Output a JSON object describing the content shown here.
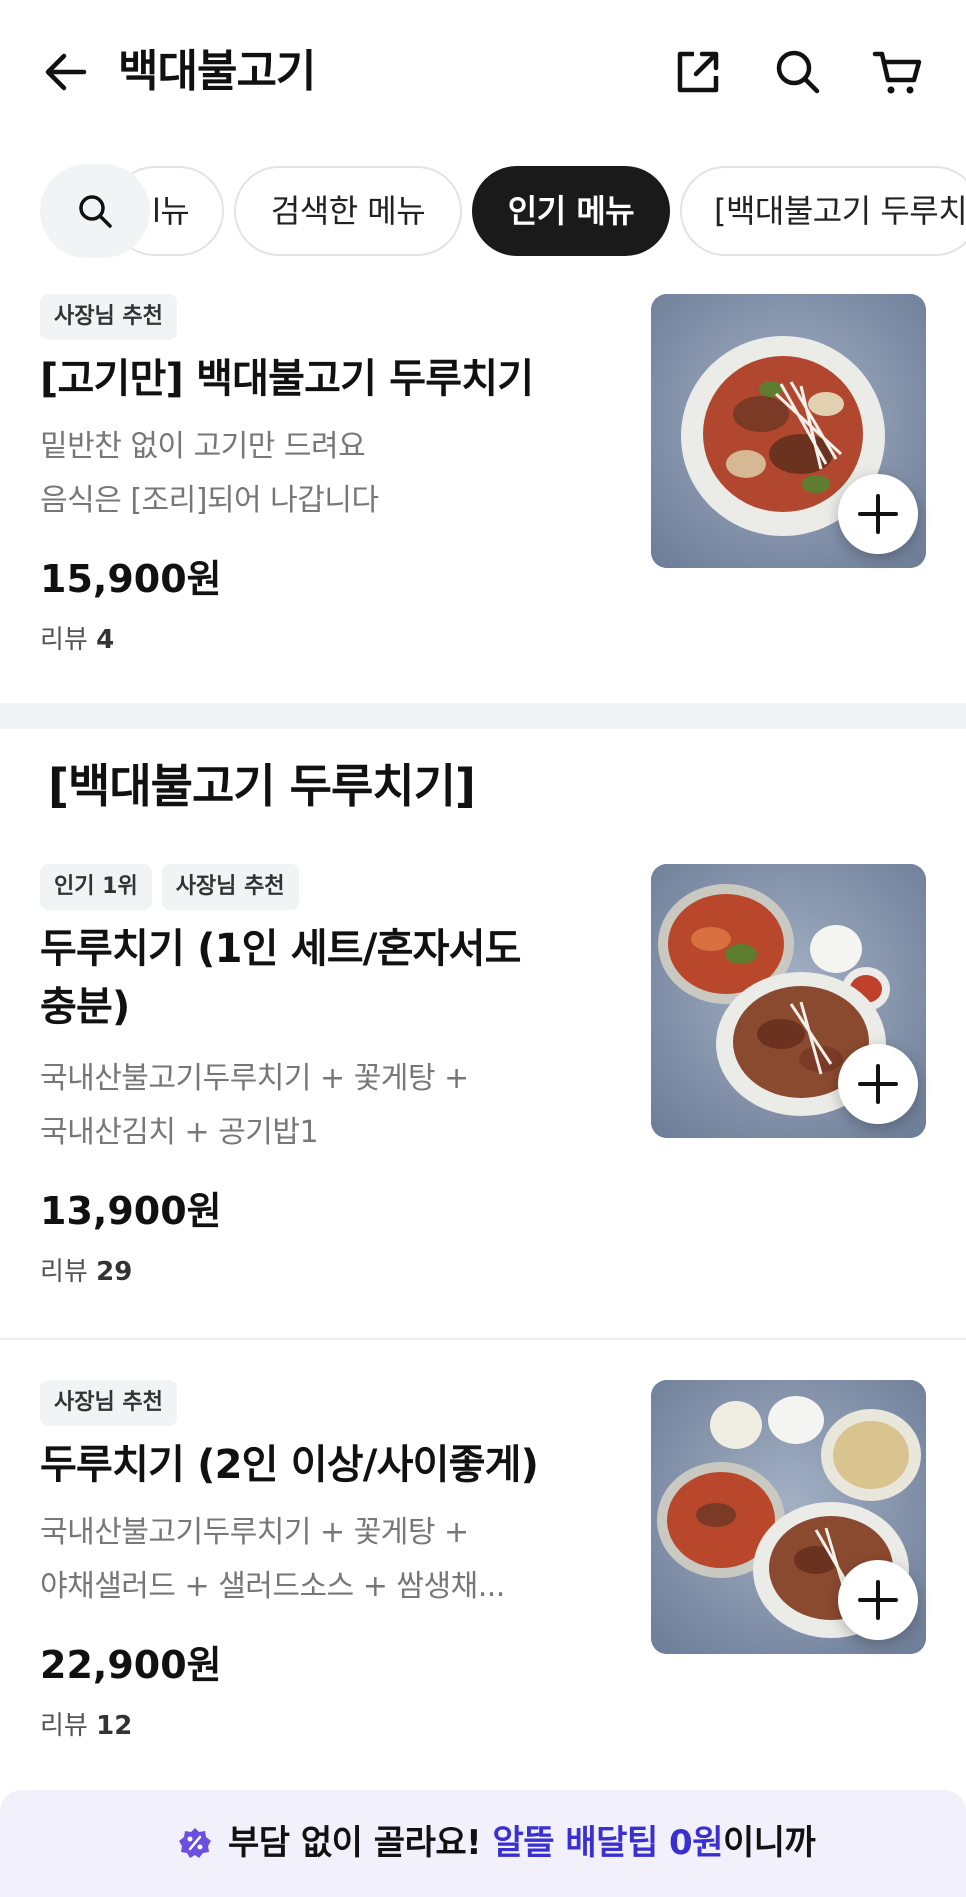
{
  "header": {
    "title": "백대불고기",
    "icons": [
      "back-arrow-icon",
      "share-icon",
      "search-icon",
      "cart-icon"
    ]
  },
  "tabs": {
    "items": [
      {
        "label": "메뉴",
        "partial_visible": "l뉴",
        "active": false
      },
      {
        "label": "검색한 메뉴",
        "active": false
      },
      {
        "label": "인기 메뉴",
        "active": true
      },
      {
        "label": "[백대불고기 두루치",
        "active": false
      }
    ]
  },
  "items": [
    {
      "badges": [
        "사장님 추천"
      ],
      "name": "[고기만] 백대불고기 두루치기",
      "desc1": "밑반찬 없이 고기만 드려요",
      "desc2": "음식은 [조리]되어 나갑니다",
      "price": "15,900원",
      "review_label": "리뷰",
      "review_count": "4"
    },
    {
      "badges": [
        "인기 1위",
        "사장님 추천"
      ],
      "name1": "두루치기 (1인 세트/혼자서도",
      "name2": "충분)",
      "desc1": "국내산불고기두루치기 + 꽃게탕 +",
      "desc2": "국내산김치 + 공기밥1",
      "price": "13,900원",
      "review_label": "리뷰",
      "review_count": "29"
    },
    {
      "badges": [
        "사장님 추천"
      ],
      "name": "두루치기 (2인 이상/사이좋게)",
      "desc1": "국내산불고기두루치기 + 꽃게탕 +",
      "desc2": "야채샐러드 + 샐러드소스 + 쌈생채...",
      "price": "22,900원",
      "review_label": "리뷰",
      "review_count": "12"
    }
  ],
  "section": {
    "title": "[백대불고기 두루치기]"
  },
  "banner": {
    "text_before": "부담 없이 골라요!",
    "text_highlight": "알뜰 배달팁 0원",
    "text_after": "이니까",
    "highlight_color": "#3a2fd0"
  },
  "colors": {
    "active_tab": "#1a1a1a",
    "badge_bg": "#f2f3f5",
    "divider": "#f2f3f5",
    "banner_bg": "#f1f0fb"
  }
}
